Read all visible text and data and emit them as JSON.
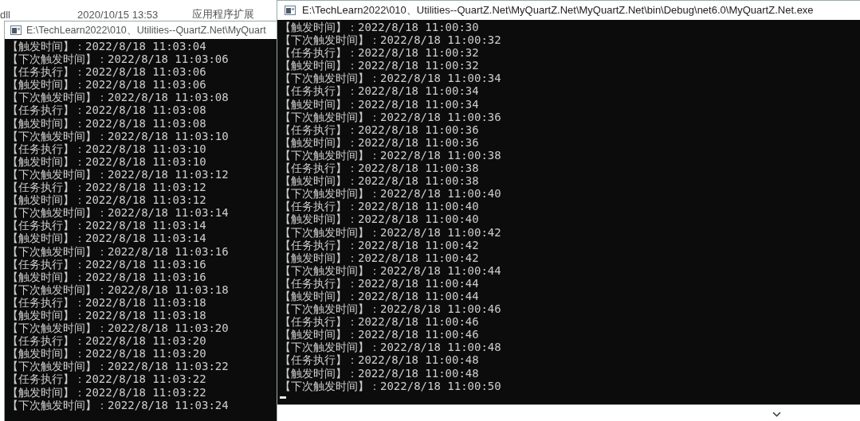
{
  "background_window": {
    "rows": [
      {
        "name": "dll",
        "modified": "2020/10/15 13:53",
        "type": "应用程序扩展"
      }
    ]
  },
  "console_windows": [
    {
      "title": "E:\\TechLearn2022\\010、Utilities--QuartZ.Net\\MyQuart",
      "lines": [
        "【触发时间】：2022/8/18 11:03:04",
        "【下次触发时间】：2022/8/18 11:03:06",
        "【任务执行】：2022/8/18 11:03:06",
        "【触发时间】：2022/8/18 11:03:06",
        "【下次触发时间】：2022/8/18 11:03:08",
        "【任务执行】：2022/8/18 11:03:08",
        "【触发时间】：2022/8/18 11:03:08",
        "【下次触发时间】：2022/8/18 11:03:10",
        "【任务执行】：2022/8/18 11:03:10",
        "【触发时间】：2022/8/18 11:03:10",
        "【下次触发时间】：2022/8/18 11:03:12",
        "【任务执行】：2022/8/18 11:03:12",
        "【触发时间】：2022/8/18 11:03:12",
        "【下次触发时间】：2022/8/18 11:03:14",
        "【任务执行】：2022/8/18 11:03:14",
        "【触发时间】：2022/8/18 11:03:14",
        "【下次触发时间】：2022/8/18 11:03:16",
        "【任务执行】：2022/8/18 11:03:16",
        "【触发时间】：2022/8/18 11:03:16",
        "【下次触发时间】：2022/8/18 11:03:18",
        "【任务执行】：2022/8/18 11:03:18",
        "【触发时间】：2022/8/18 11:03:18",
        "【下次触发时间】：2022/8/18 11:03:20",
        "【任务执行】：2022/8/18 11:03:20",
        "【触发时间】：2022/8/18 11:03:20",
        "【下次触发时间】：2022/8/18 11:03:22",
        "【任务执行】：2022/8/18 11:03:22",
        "【触发时间】：2022/8/18 11:03:22",
        "【下次触发时间】：2022/8/18 11:03:24"
      ]
    },
    {
      "title": "E:\\TechLearn2022\\010、Utilities--QuartZ.Net\\MyQuartZ.Net\\MyQuartZ.Net\\bin\\Debug\\net6.0\\MyQuartZ.Net.exe",
      "cursor": true,
      "lines": [
        "【触发时间】：2022/8/18 11:00:30",
        "【下次触发时间】：2022/8/18 11:00:32",
        "【任务执行】：2022/8/18 11:00:32",
        "【触发时间】：2022/8/18 11:00:32",
        "【下次触发时间】：2022/8/18 11:00:34",
        "【任务执行】：2022/8/18 11:00:34",
        "【触发时间】：2022/8/18 11:00:34",
        "【下次触发时间】：2022/8/18 11:00:36",
        "【任务执行】：2022/8/18 11:00:36",
        "【触发时间】：2022/8/18 11:00:36",
        "【下次触发时间】：2022/8/18 11:00:38",
        "【任务执行】：2022/8/18 11:00:38",
        "【触发时间】：2022/8/18 11:00:38",
        "【下次触发时间】：2022/8/18 11:00:40",
        "【任务执行】：2022/8/18 11:00:40",
        "【触发时间】：2022/8/18 11:00:40",
        "【下次触发时间】：2022/8/18 11:00:42",
        "【任务执行】：2022/8/18 11:00:42",
        "【触发时间】：2022/8/18 11:00:42",
        "【下次触发时间】：2022/8/18 11:00:44",
        "【任务执行】：2022/8/18 11:00:44",
        "【触发时间】：2022/8/18 11:00:44",
        "【下次触发时间】：2022/8/18 11:00:46",
        "【任务执行】：2022/8/18 11:00:46",
        "【触发时间】：2022/8/18 11:00:46",
        "【下次触发时间】：2022/8/18 11:00:48",
        "【任务执行】：2022/8/18 11:00:48",
        "【触发时间】：2022/8/18 11:00:48",
        "【下次触发时间】：2022/8/18 11:00:50"
      ]
    }
  ]
}
